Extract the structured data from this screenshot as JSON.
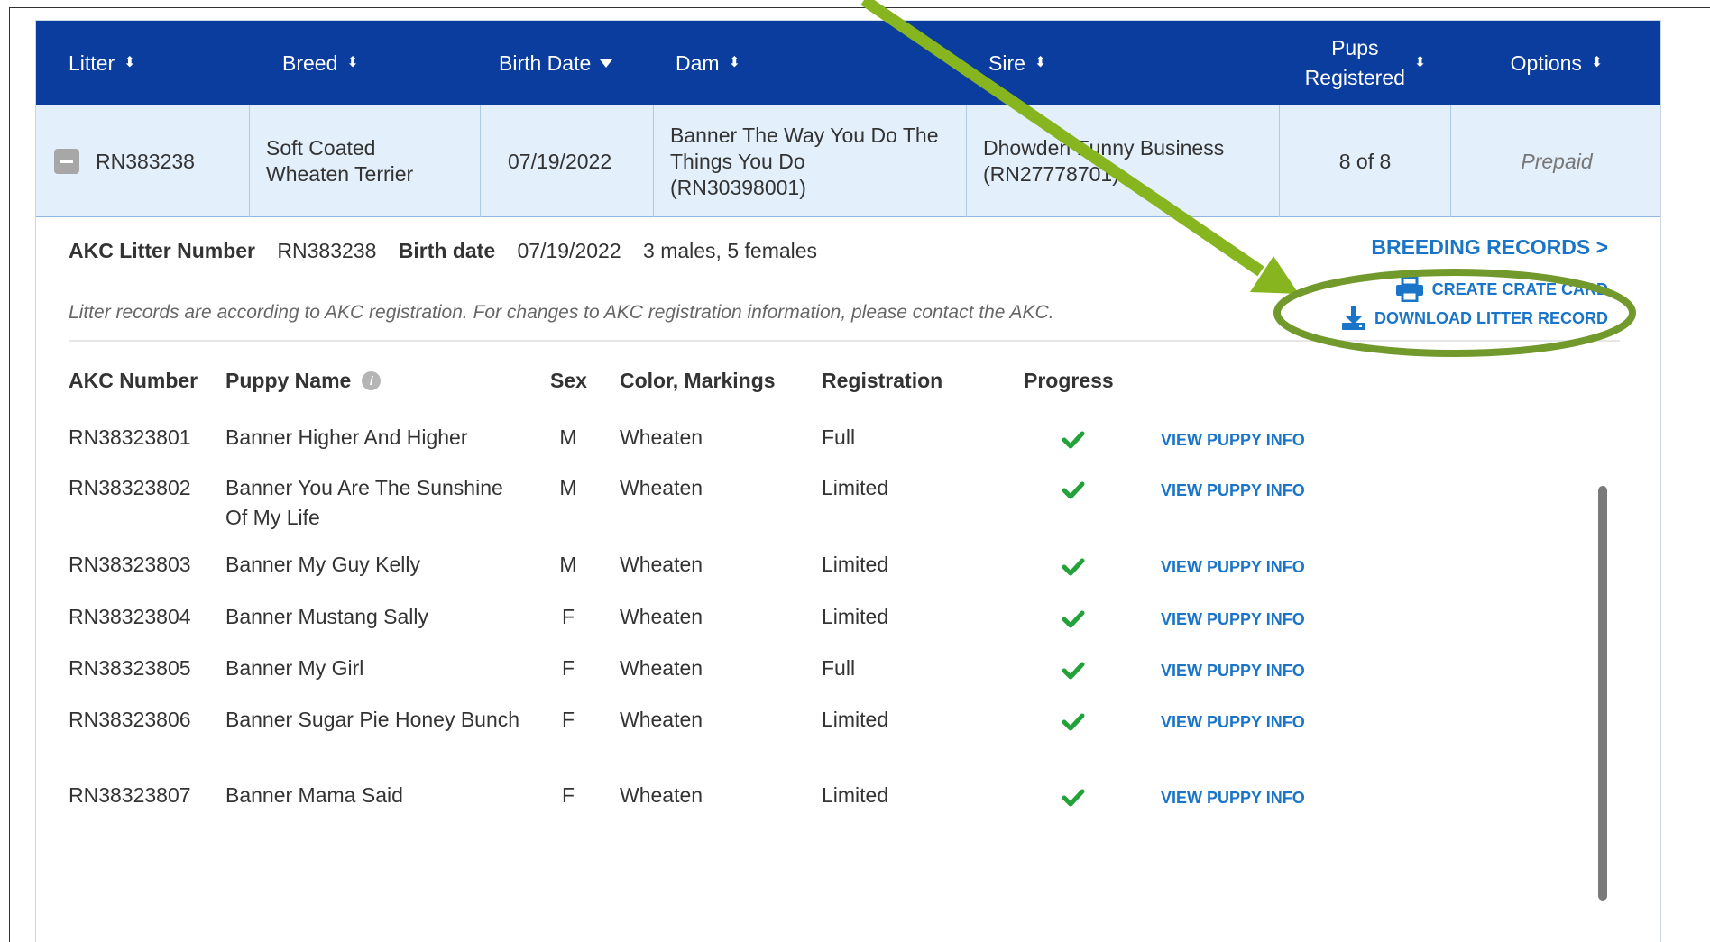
{
  "table": {
    "columns": [
      {
        "label": "Litter"
      },
      {
        "label": "Breed"
      },
      {
        "label": "Birth Date"
      },
      {
        "label": "Dam"
      },
      {
        "label": "Sire"
      },
      {
        "label_line1": "Pups",
        "label_line2": "Registered"
      },
      {
        "label": "Options"
      }
    ],
    "litter_row": {
      "litter": "RN383238",
      "breed_line1": "Soft Coated",
      "breed_line2": "Wheaten Terrier",
      "birth_date": "07/19/2022",
      "dam_line1": "Banner The Way You Do The",
      "dam_line2": "Things You Do",
      "dam_line3": "(RN30398001)",
      "sire_line1": "Dhowden Funny Business",
      "sire_line2": "(RN27778701)",
      "pups_registered": "8 of 8",
      "options": "Prepaid"
    }
  },
  "detail": {
    "litter_number_label": "AKC Litter Number",
    "litter_number": "RN383238",
    "birth_date_label": "Birth date",
    "birth_date": "07/19/2022",
    "counts": "3 males, 5 females",
    "note": "Litter records are according to AKC registration. For changes to AKC registration information, please contact the AKC.",
    "breeding_records": "BREEDING RECORDS >",
    "create_crate_card": "CREATE CRATE CARD",
    "download_litter_record": "DOWNLOAD LITTER RECORD"
  },
  "puppies": {
    "headers": {
      "akc_number": "AKC Number",
      "puppy_name": "Puppy Name",
      "sex": "Sex",
      "color": "Color, Markings",
      "registration": "Registration",
      "progress": "Progress"
    },
    "info_icon": "i",
    "view_label": "VIEW PUPPY INFO",
    "rows": [
      {
        "number": "RN38323801",
        "name": "Banner Higher And Higher",
        "sex": "M",
        "color": "Wheaten",
        "registration": "Full"
      },
      {
        "number": "RN38323802",
        "name": "Banner You Are The Sunshine Of My Life",
        "sex": "M",
        "color": "Wheaten",
        "registration": "Limited"
      },
      {
        "number": "RN38323803",
        "name": "Banner My Guy Kelly",
        "sex": "M",
        "color": "Wheaten",
        "registration": "Limited"
      },
      {
        "number": "RN38323804",
        "name": "Banner Mustang Sally",
        "sex": "F",
        "color": "Wheaten",
        "registration": "Limited"
      },
      {
        "number": "RN38323805",
        "name": "Banner My Girl",
        "sex": "F",
        "color": "Wheaten",
        "registration": "Full"
      },
      {
        "number": "RN38323806",
        "name": "Banner Sugar Pie Honey Bunch",
        "sex": "F",
        "color": "Wheaten",
        "registration": "Limited"
      },
      {
        "number": "RN38323807",
        "name": "Banner Mama Said",
        "sex": "F",
        "color": "Wheaten",
        "registration": "Limited"
      }
    ]
  },
  "colors": {
    "header_bg": "#0a3d9e",
    "row_bg": "#e3effa",
    "link": "#1a74c7",
    "check": "#22a33a",
    "annotation": "#78a22f"
  },
  "icons": {
    "sort": "sort-arrows-icon",
    "sort_desc": "sort-desc-icon",
    "collapse": "minus-square-icon",
    "print": "printer-icon",
    "download": "download-icon",
    "check": "checkmark-icon",
    "info": "info-circle-icon"
  }
}
